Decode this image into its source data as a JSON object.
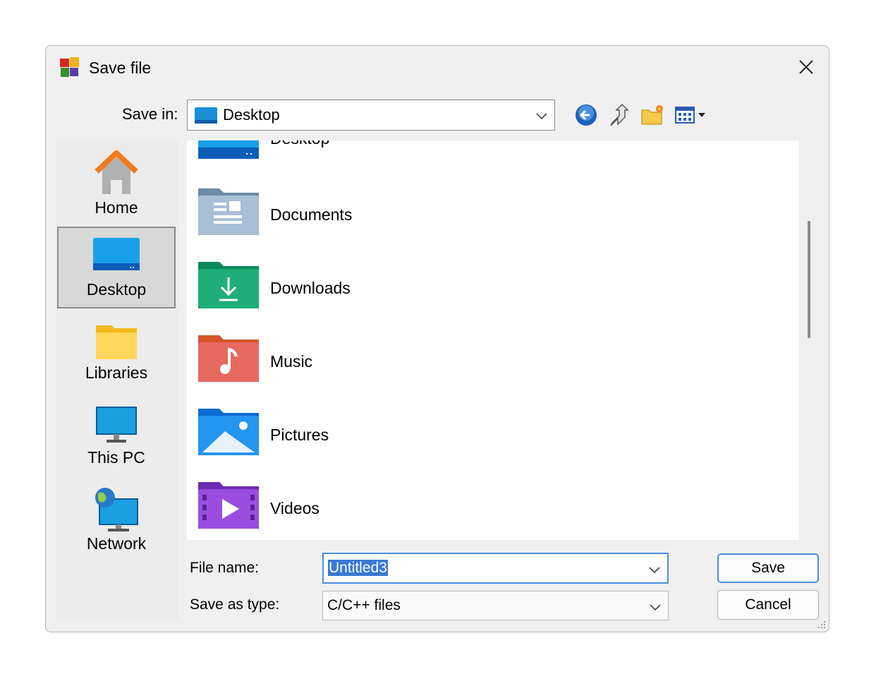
{
  "window": {
    "title": "Save file",
    "icon": "app-logo-icon",
    "close_icon": "close-icon"
  },
  "toolbar": {
    "save_in_label": "Save in:",
    "save_in_value": "Desktop",
    "buttons": [
      "back-icon",
      "up-folder-icon",
      "new-folder-icon",
      "view-menu-icon"
    ]
  },
  "places": [
    {
      "label": "Home",
      "icon": "home-icon"
    },
    {
      "label": "Desktop",
      "icon": "desktop-icon",
      "selected": true
    },
    {
      "label": "Libraries",
      "icon": "libraries-icon"
    },
    {
      "label": "This PC",
      "icon": "this-pc-icon"
    },
    {
      "label": "Network",
      "icon": "network-icon"
    }
  ],
  "files": [
    {
      "name": "Desktop",
      "icon": "desktop-folder-icon"
    },
    {
      "name": "Documents",
      "icon": "documents-folder-icon"
    },
    {
      "name": "Downloads",
      "icon": "downloads-folder-icon"
    },
    {
      "name": "Music",
      "icon": "music-folder-icon"
    },
    {
      "name": "Pictures",
      "icon": "pictures-folder-icon"
    },
    {
      "name": "Videos",
      "icon": "videos-folder-icon"
    }
  ],
  "form": {
    "file_name_label": "File name:",
    "file_name_value": "Untitled3",
    "save_as_type_label": "Save as type:",
    "save_as_type_value": "C/C++ files",
    "save_button": "Save",
    "cancel_button": "Cancel"
  },
  "colors": {
    "accent": "#4a8fdb",
    "selection": "#3a78d4"
  }
}
